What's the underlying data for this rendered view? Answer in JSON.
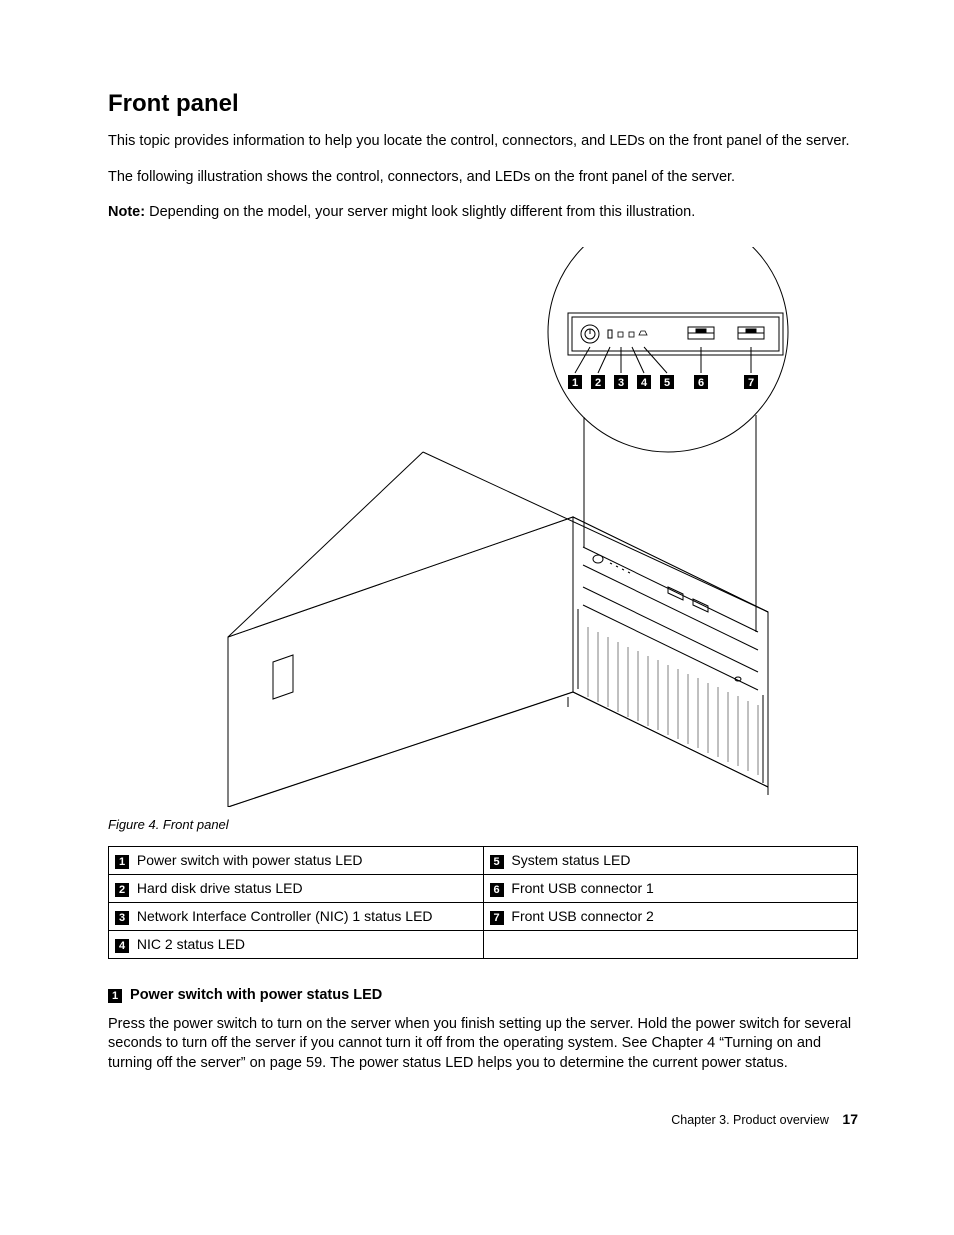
{
  "heading": "Front panel",
  "intro_p1": "This topic provides information to help you locate the control, connectors, and LEDs on the front panel of the server.",
  "intro_p2": "The following illustration shows the control, connectors, and LEDs on the front panel of the server.",
  "note_label": "Note:",
  "note_text": " Depending on the model, your server might look slightly different from this illustration.",
  "figure_caption": "Figure 4.  Front panel",
  "callouts": {
    "r1c1_num": "1",
    "r1c1_txt": " Power switch with power status LED",
    "r1c2_num": "5",
    "r1c2_txt": " System status LED",
    "r2c1_num": "2",
    "r2c1_txt": " Hard disk drive status LED",
    "r2c2_num": "6",
    "r2c2_txt": " Front USB connector 1",
    "r3c1_num": "3",
    "r3c1_txt": " Network Interface Controller (NIC) 1 status LED",
    "r3c2_num": "7",
    "r3c2_txt": " Front USB connector 2",
    "r4c1_num": "4",
    "r4c1_txt": " NIC 2 status LED",
    "r4c2_txt": ""
  },
  "section1": {
    "num": "1",
    "title": " Power switch with power status LED",
    "body": "Press the power switch to turn on the server when you finish setting up the server. Hold the power switch for several seconds to turn off the server if you cannot turn it off from the operating system. See Chapter 4 “Turning on and turning off the server” on page 59. The power status LED helps you to determine the current power status."
  },
  "diagram_labels": {
    "n1": "1",
    "n2": "2",
    "n3": "3",
    "n4": "4",
    "n5": "5",
    "n6": "6",
    "n7": "7"
  },
  "footer_chapter": "Chapter 3. Product overview",
  "footer_page": "17"
}
